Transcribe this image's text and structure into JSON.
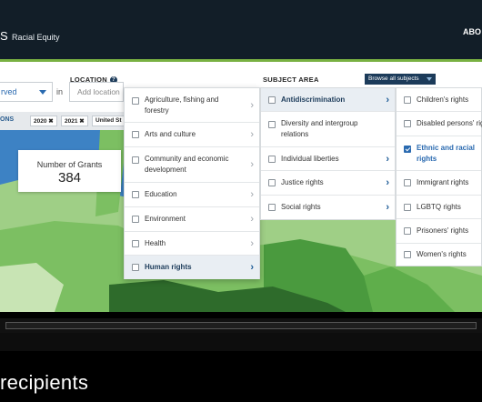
{
  "header": {
    "logo_fragment": "S",
    "brand_subtitle": "Racial Equity",
    "about_link": "ABO"
  },
  "filters": {
    "location_label": "LOCATION",
    "subject_label": "SUBJECT AREA",
    "served_select_value": "rved",
    "in_word": "in",
    "location_placeholder": "Add location",
    "browse_button": "Browse all subjects",
    "chips_label": "ONS",
    "chips": [
      "2020 ✖",
      "2021 ✖",
      "United St"
    ]
  },
  "stats": {
    "label": "Number of Grants",
    "value": "384"
  },
  "subject_menu": {
    "left_items": [
      {
        "label": "Agriculture, fishing and forestry",
        "checked": false,
        "active": false
      },
      {
        "label": "Arts and culture",
        "checked": false,
        "active": false
      },
      {
        "label": "Community and economic development",
        "checked": false,
        "active": false
      },
      {
        "label": "Education",
        "checked": false,
        "active": false
      },
      {
        "label": "Environment",
        "checked": false,
        "active": false
      },
      {
        "label": "Health",
        "checked": false,
        "active": false
      },
      {
        "label": "Human rights",
        "checked": false,
        "active": true
      }
    ],
    "middle_items": [
      {
        "label": "Antidiscrimination",
        "checked": false,
        "active": true
      },
      {
        "label": "Diversity and intergroup relations",
        "checked": false,
        "active": false
      },
      {
        "label": "Individual liberties",
        "checked": false,
        "active": false
      },
      {
        "label": "Justice rights",
        "checked": false,
        "active": false
      },
      {
        "label": "Social rights",
        "checked": false,
        "active": false
      }
    ],
    "right_items": [
      {
        "label": "Children's rights",
        "checked": false
      },
      {
        "label": "Disabled persons' rights",
        "checked": false
      },
      {
        "label": "Ethnic and racial rights",
        "checked": true
      },
      {
        "label": "Immigrant rights",
        "checked": false
      },
      {
        "label": "LGBTQ rights",
        "checked": false
      },
      {
        "label": "Prisoners' rights",
        "checked": false
      },
      {
        "label": "Women's rights",
        "checked": false
      }
    ]
  },
  "caption": "recipients",
  "colors": {
    "header_bg": "#121e28",
    "accent_green": "#79b142",
    "link_blue": "#2a6ab0",
    "navy": "#1c3b5a"
  }
}
